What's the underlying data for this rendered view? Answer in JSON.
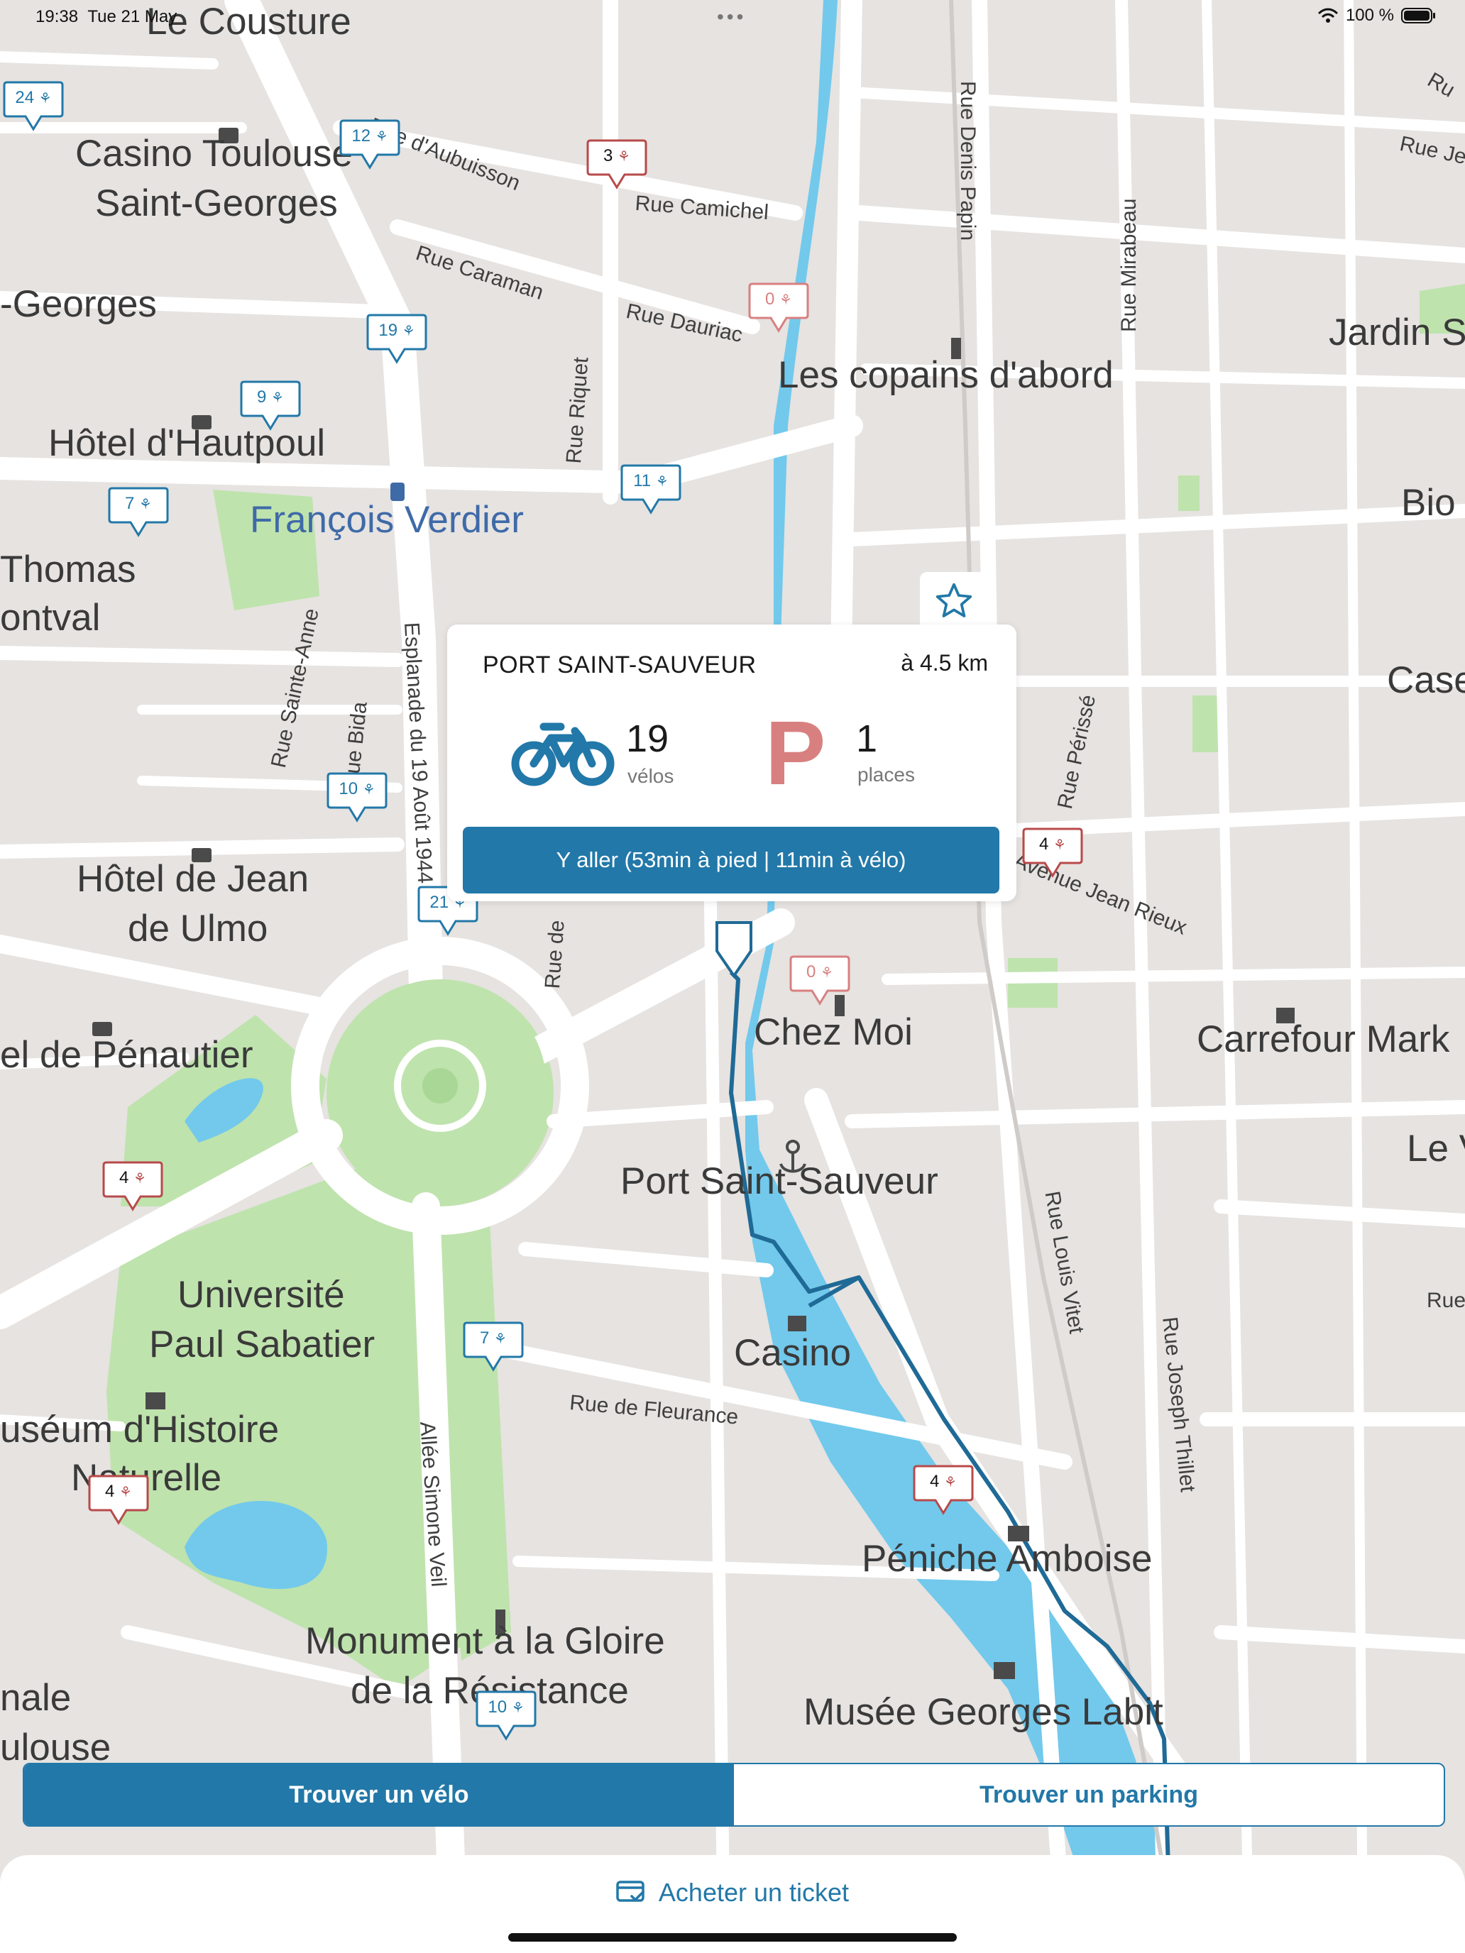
{
  "status_bar": {
    "time": "19:38",
    "date": "Tue 21 May",
    "battery": "100 %"
  },
  "map_labels": {
    "le_cousture": "Le Cousture",
    "casino_toulouse_1": "Casino Toulouse",
    "casino_toulouse_2": "Saint-Georges",
    "georges": "-Georges",
    "hotel_hautpoul": "Hôtel d'Hautpoul",
    "thomas": "Thomas",
    "ontval": "ontval",
    "francois_verdier": "François Verdier",
    "les_copains": "Les copains d'abord",
    "jardin": "Jardin S",
    "bio": "Bio",
    "case": "Case",
    "hotel_jean_1": "Hôtel de Jean",
    "hotel_jean_2": "de Ulmo",
    "penautier": "el de Pénautier",
    "chez_moi": "Chez Moi",
    "carrefour": "Carrefour Mark",
    "le_v": "Le V",
    "port_saint_sauveur": "Port Saint-Sauveur",
    "universite_1": "Université",
    "universite_2": "Paul Sabatier",
    "casino": "Casino",
    "museum_1": "uséum d'Histoire",
    "museum_2": "Naturelle",
    "peniche": "Péniche Amboise",
    "monument_1": "Monument à la Gloire",
    "monument_2": "de la Résistance",
    "musee_labit": "Musée Georges Labit",
    "nale": "nale",
    "ulouse": "ulouse",
    "rue_aubuisson": "Rue d'Aubuisson",
    "rue_camichel": "Rue Camichel",
    "rue_caraman": "Rue Caraman",
    "rue_dauriac": "Rue Dauriac",
    "rue_denis_papin": "Rue Denis Papin",
    "rue_mirabeau": "Rue Mirabeau",
    "rue_riquet": "Rue Riquet",
    "rue_sainte_anne": "Rue Sainte-Anne",
    "rue_bida": "Rue Bida",
    "esplanade": "Esplanade du 19 Août 1944",
    "rue_perisse": "Rue Périssé",
    "rue_jean_rieux": "Avenue Jean Rieux",
    "rue_de": "Rue de",
    "rue_fleurance": "Rue de Fleurance",
    "rue_louis_vitet": "Rue Louis Vitet",
    "rue_joseph_thillet": "Rue Joseph Thillet",
    "allee_simone_veil": "Allée Simone Veil",
    "rue_ru": "Rue",
    "rue_je": "Rue Je",
    "rue_ru2": "Ru"
  },
  "markers": [
    {
      "id": "m24",
      "count": "24",
      "color": "#2278a8"
    },
    {
      "id": "m12",
      "count": "12",
      "color": "#2278a8"
    },
    {
      "id": "m3",
      "count": "3",
      "color": "#b84a4a"
    },
    {
      "id": "m0a",
      "count": "0",
      "color": "#d88080"
    },
    {
      "id": "m19",
      "count": "19",
      "color": "#2278a8"
    },
    {
      "id": "m9",
      "count": "9",
      "color": "#2278a8"
    },
    {
      "id": "m7a",
      "count": "7",
      "color": "#2278a8"
    },
    {
      "id": "m11",
      "count": "11",
      "color": "#2278a8"
    },
    {
      "id": "m10a",
      "count": "10",
      "color": "#2278a8"
    },
    {
      "id": "m21",
      "count": "21",
      "color": "#2278a8"
    },
    {
      "id": "m4a",
      "count": "4",
      "color": "#b84a4a"
    },
    {
      "id": "m0b",
      "count": "0",
      "color": "#d88080"
    },
    {
      "id": "m4b",
      "count": "4",
      "color": "#b84a4a"
    },
    {
      "id": "m7b",
      "count": "7",
      "color": "#2278a8"
    },
    {
      "id": "m4c",
      "count": "4",
      "color": "#b84a4a"
    },
    {
      "id": "m4d",
      "count": "4",
      "color": "#b84a4a"
    },
    {
      "id": "m10b",
      "count": "10",
      "color": "#2278a8"
    }
  ],
  "station_card": {
    "name": "PORT SAINT-SAUVEUR",
    "distance": "à 4.5 km",
    "bikes_count": "19",
    "bikes_label": "vélos",
    "parking_letter": "P",
    "places_count": "1",
    "places_label": "places",
    "go_button": "Y aller (53min à pied | 11min à vélo)"
  },
  "segmented": {
    "find_bike": "Trouver un vélo",
    "find_parking": "Trouver un parking",
    "selected": "find_bike"
  },
  "bottom": {
    "buy_ticket": "Acheter un ticket"
  },
  "colors": {
    "accent": "#2278a8",
    "parking": "#d88080",
    "water": "#72c9ec",
    "park": "#bfe3ad",
    "road": "#ffffff"
  }
}
